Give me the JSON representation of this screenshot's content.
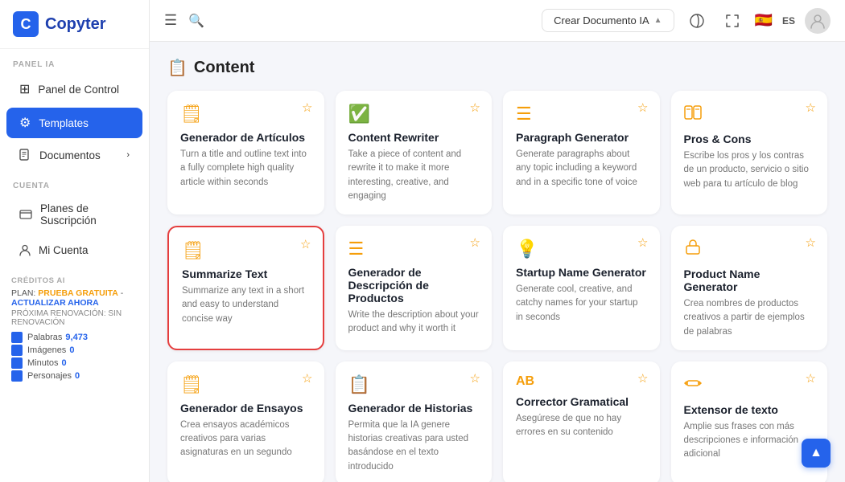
{
  "logo": {
    "letter": "C",
    "name": "Copyter"
  },
  "sidebar": {
    "panel_label": "PANEL IA",
    "items": [
      {
        "id": "panel",
        "label": "Panel de Control",
        "icon": "⊞",
        "active": false,
        "arrow": false
      },
      {
        "id": "templates",
        "label": "Templates",
        "icon": "⚙",
        "active": true,
        "arrow": false
      },
      {
        "id": "documentos",
        "label": "Documentos",
        "icon": "🗋",
        "active": false,
        "arrow": true
      }
    ],
    "cuenta_label": "CUENTA",
    "cuenta_items": [
      {
        "id": "planes",
        "label": "Planes de Suscripción",
        "icon": "💳",
        "active": false
      },
      {
        "id": "micuenta",
        "label": "Mi Cuenta",
        "icon": "👤",
        "active": false
      }
    ],
    "credits_label": "CRÉDITOS AI",
    "plan_label": "PLAN:",
    "plan_name": "PRUEBA GRATUITA",
    "plan_sep": " - ",
    "plan_update": "ACTUALIZAR AHORA",
    "renovacion": "PRÓXIMA RENOVACIÓN: SIN RENOVACIÓN",
    "credit_rows": [
      {
        "label": "Palabras",
        "value": "9,473"
      },
      {
        "label": "Imágenes",
        "value": "0"
      },
      {
        "label": "Minutos",
        "value": "0"
      },
      {
        "label": "Personajes",
        "value": "0"
      }
    ]
  },
  "header": {
    "create_btn": "Crear Documento IA",
    "lang": "ES"
  },
  "content": {
    "section_icon": "📋",
    "section_title": "Content",
    "row1": [
      {
        "id": "gen-articulos",
        "icon": "🗒",
        "title": "Generador de Artículos",
        "desc": "Turn a title and outline text into a fully complete high quality article within seconds",
        "highlighted": false
      },
      {
        "id": "content-rewriter",
        "icon": "✅",
        "title": "Content Rewriter",
        "desc": "Take a piece of content and rewrite it to make it more interesting, creative, and engaging",
        "highlighted": false
      },
      {
        "id": "paragraph-gen",
        "icon": "☰",
        "title": "Paragraph Generator",
        "desc": "Generate paragraphs about any topic including a keyword and in a specific tone of voice",
        "highlighted": false
      },
      {
        "id": "pros-cons",
        "icon": "📊",
        "title": "Pros & Cons",
        "desc": "Escribe los pros y los contras de un producto, servicio o sitio web para tu artículo de blog",
        "highlighted": false
      }
    ],
    "row2": [
      {
        "id": "summarize-text",
        "icon": "🗒",
        "title": "Summarize Text",
        "desc": "Summarize any text in a short and easy to understand concise way",
        "highlighted": true
      },
      {
        "id": "gen-descripcion",
        "icon": "☰",
        "title": "Generador de Descripción de Productos",
        "desc": "Write the description about your product and why it worth it",
        "highlighted": false
      },
      {
        "id": "startup-name",
        "icon": "💡",
        "title": "Startup Name Generator",
        "desc": "Generate cool, creative, and catchy names for your startup in seconds",
        "highlighted": false
      },
      {
        "id": "product-name",
        "icon": "🏷",
        "title": "Product Name Generator",
        "desc": "Crea nombres de productos creativos a partir de ejemplos de palabras",
        "highlighted": false
      }
    ],
    "row3": [
      {
        "id": "gen-ensayos",
        "icon": "🗒",
        "title": "Generador de Ensayos",
        "desc": "Crea ensayos académicos creativos para varias asignaturas en un segundo",
        "highlighted": false
      },
      {
        "id": "gen-historias",
        "icon": "📋",
        "title": "Generador de Historias",
        "desc": "Permita que la IA genere historias creativas para usted basándose en el texto introducido",
        "highlighted": false
      },
      {
        "id": "corrector-gram",
        "icon": "AB",
        "title": "Corrector Gramatical",
        "desc": "Asegúrese de que no hay errores en su contenido",
        "highlighted": false
      },
      {
        "id": "extensor-texto",
        "icon": "⇔",
        "title": "Extensor de texto",
        "desc": "Amplie sus frases con más descripciones e información adicional",
        "highlighted": false
      }
    ]
  },
  "scroll_up_btn": "▲"
}
